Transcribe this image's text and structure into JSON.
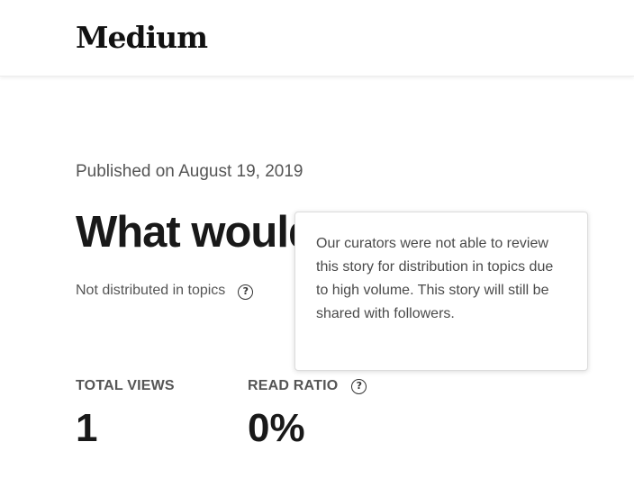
{
  "header": {
    "logo": "Medium"
  },
  "story": {
    "published": "Published on August 19, 2019",
    "title": "What would you do?",
    "distribution_status": "Not distributed in topics",
    "help_icon": "question-circle-icon"
  },
  "tooltip": {
    "text": "Our curators were not able to review this story for distribution in topics due to high volume. This story will still be shared with followers."
  },
  "stats": {
    "total_views": {
      "label": "TOTAL VIEWS",
      "value": "1"
    },
    "read_ratio": {
      "label": "READ RATIO",
      "value": "0%",
      "help_icon": "question-circle-icon"
    }
  }
}
